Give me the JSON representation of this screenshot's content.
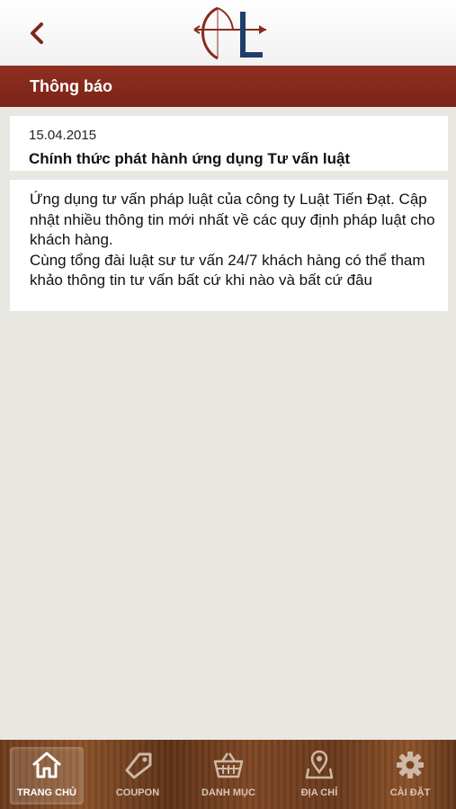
{
  "header": {
    "back_icon": "chevron-left-icon",
    "logo_icon": "bow-arrow-logo-icon"
  },
  "titlebar": {
    "title": "Thông báo"
  },
  "notification": {
    "date": "15.04.2015",
    "title": "Chính thức phát hành ứng dụng Tư vấn luật",
    "body": "Ứng dụng tư vấn pháp luật của công ty Luật Tiến Đạt. Cập nhật nhiều thông tin mới nhất về các quy định pháp luật cho khách hàng.\nCùng tổng đài luật sư tư vấn 24/7 khách hàng có thể tham khảo thông tin tư vấn bất cứ khi nào và bất cứ đâu"
  },
  "tabbar": {
    "items": [
      {
        "label": "TRANG CHỦ",
        "icon": "home-icon",
        "active": true
      },
      {
        "label": "COUPON",
        "icon": "tag-icon",
        "active": false
      },
      {
        "label": "DANH MỤC",
        "icon": "basket-icon",
        "active": false
      },
      {
        "label": "ĐỊA CHỈ",
        "icon": "map-pin-icon",
        "active": false
      },
      {
        "label": "CÀI ĐẶT",
        "icon": "gear-icon",
        "active": false
      }
    ]
  },
  "colors": {
    "brand": "#7f2719",
    "background": "#e9e7e1",
    "tabbar": "#7a4422"
  }
}
